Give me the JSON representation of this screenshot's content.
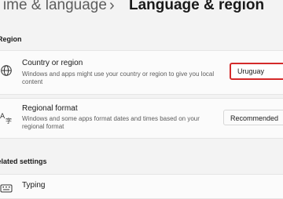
{
  "breadcrumb": {
    "parent": "Time & language",
    "separator": "›",
    "current": "Language & region"
  },
  "region_section": {
    "label": "Region"
  },
  "country_row": {
    "icon": "globe-icon",
    "title": "Country or region",
    "description": "Windows and apps might use your country or region to give you local content",
    "value": "Uruguay"
  },
  "format_row": {
    "icon": "regional-format-icon",
    "title": "Regional format",
    "description": "Windows and some apps format dates and times based on your regional format",
    "value": "Recommended"
  },
  "related_section": {
    "label": "Related settings"
  },
  "typing_row": {
    "icon": "keyboard-icon",
    "title": "Typing"
  },
  "colors": {
    "highlight": "#d42a2a",
    "page_background": "#f3f3f3",
    "card_background": "#fbfbfb"
  }
}
